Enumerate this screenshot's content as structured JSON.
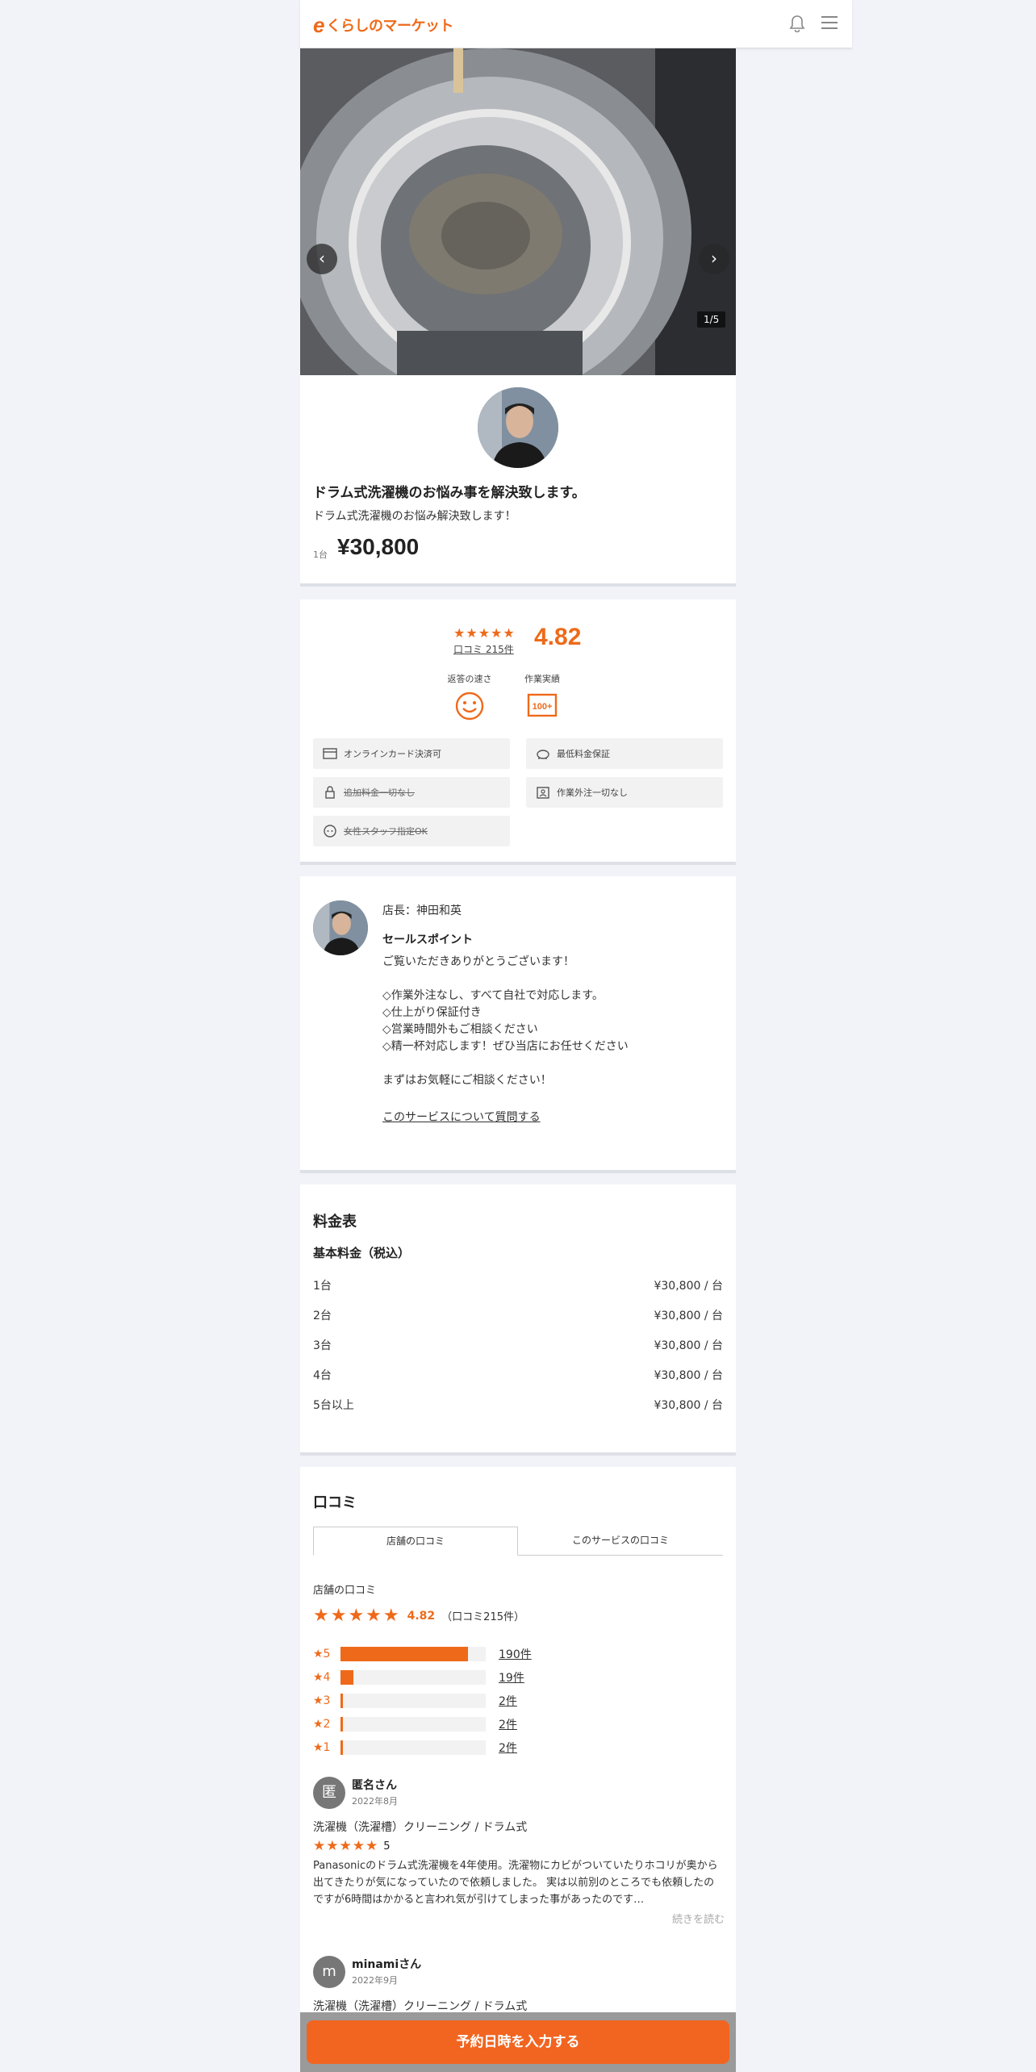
{
  "header": {
    "logo_mark": "e",
    "logo_text": "くらしのマーケット"
  },
  "hero": {
    "counter": "1/5",
    "prev": "‹",
    "next": "›"
  },
  "service": {
    "title": "ドラム式洗濯機のお悩み事を解決致します。",
    "subtitle": "ドラム式洗濯機のお悩み解決致します！",
    "unit": "1台",
    "price": "¥30,800"
  },
  "rating": {
    "stars": "★★★★★",
    "review_link": "口コミ 215件",
    "score": "4.82",
    "badges": [
      {
        "label": "返答の速さ",
        "icon": "smile-icon"
      },
      {
        "label": "作業実績",
        "icon": "100-plus-icon"
      }
    ],
    "features": [
      {
        "label": "オンラインカード決済可",
        "icon": "card-icon",
        "strike": false
      },
      {
        "label": "最低料金保証",
        "icon": "piggy-bank-icon",
        "strike": false
      },
      {
        "label": "追加料金一切なし",
        "icon": "lock-icon",
        "strike": true
      },
      {
        "label": "作業外注一切なし",
        "icon": "id-badge-icon",
        "strike": false
      },
      {
        "label": "女性スタッフ指定OK",
        "icon": "female-staff-icon",
        "strike": true
      }
    ]
  },
  "store": {
    "manager": "店長：神田和英",
    "sales_title": "セールスポイント",
    "sales_body": "ご覧いただきありがとうございます！\n\n◇作業外注なし、すべて自社で対応します。\n◇仕上がり保証付き\n◇営業時間外もご相談ください\n◇精一杯対応します！ぜひ当店にお任せください\n\nまずはお気軽にご相談ください！",
    "ask_link": "このサービスについて質問する"
  },
  "pricing": {
    "title": "料金表",
    "subtitle": "基本料金（税込）",
    "rows": [
      {
        "qty": "1台",
        "price": "¥30,800 / 台"
      },
      {
        "qty": "2台",
        "price": "¥30,800 / 台"
      },
      {
        "qty": "3台",
        "price": "¥30,800 / 台"
      },
      {
        "qty": "4台",
        "price": "¥30,800 / 台"
      },
      {
        "qty": "5台以上",
        "price": "¥30,800 / 台"
      }
    ]
  },
  "reviews": {
    "title": "口コミ",
    "tabs": [
      "店舗の口コミ",
      "このサービスの口コミ"
    ],
    "section_label": "店舗の口コミ",
    "stars": "★★★★★",
    "score": "4.82",
    "count_text": "（口コミ215件）",
    "distribution": [
      {
        "label": "★5",
        "count": "190件",
        "fraction": 0.88
      },
      {
        "label": "★4",
        "count": "19件",
        "fraction": 0.09
      },
      {
        "label": "★3",
        "count": "2件",
        "fraction": 0.01
      },
      {
        "label": "★2",
        "count": "2件",
        "fraction": 0.01
      },
      {
        "label": "★1",
        "count": "2件",
        "fraction": 0.01
      }
    ],
    "items": [
      {
        "avatar": "匿",
        "name": "匿名さん",
        "date": "2022年8月",
        "service": "洗濯機（洗濯槽）クリーニング / ドラム式",
        "stars": "★★★★★",
        "score": "5",
        "body": "Panasonicのドラム式洗濯機を4年使用。洗濯物にカビがついていたりホコリが奥から出てきたりが気になっていたので依頼しました。 実は以前別のところでも依頼したのですが6時間はかかると言われ気が引けてしまった事があったのです…",
        "more": "続きを読む"
      },
      {
        "avatar": "m",
        "name": "minamiさん",
        "date": "2022年9月",
        "service": "洗濯機（洗濯槽）クリーニング / ドラム式"
      }
    ]
  },
  "cta": {
    "label": "予約日時を入力する"
  },
  "colors": {
    "accent": "#ee6a1a",
    "cta": "#f16521"
  }
}
